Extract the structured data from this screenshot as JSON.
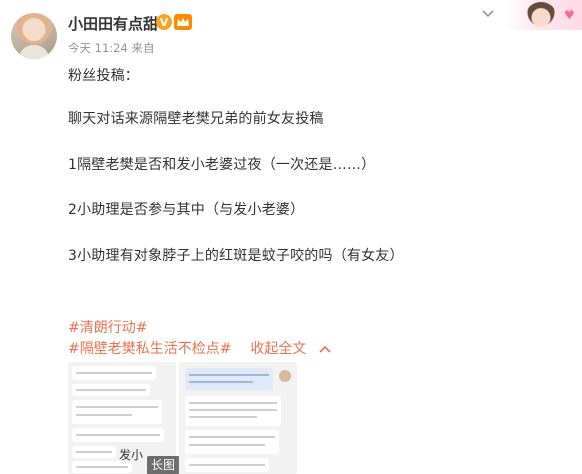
{
  "post": {
    "username": "小田田有点甜",
    "vip_badge": "V",
    "meta": "今天 11:24 来自",
    "lines": [
      "粉丝投稿：",
      "聊天对话来源隔壁老樊兄弟的前女友投稿",
      "1隔壁老樊是否和发小老婆过夜（一次还是……）",
      "2小助理是否参与其中（与发小老婆）",
      "3小助理有对象脖子上的红斑是蚊子咬的吗（有女友）"
    ],
    "topic_1": "#清朗行动#",
    "topic_2": "#隔壁老樊私生活不检点#",
    "expand_label": "收起全文",
    "thumb_overlay_text": "发小",
    "long_image_badge": "长图"
  },
  "icons": {
    "menu": "chevron-down-icon",
    "expand": "chevron-up-icon",
    "vip": "vip-crown-icon"
  },
  "colors": {
    "link": "#eb7350",
    "text": "#333333",
    "meta": "#939393",
    "vip": "#f5a623"
  }
}
